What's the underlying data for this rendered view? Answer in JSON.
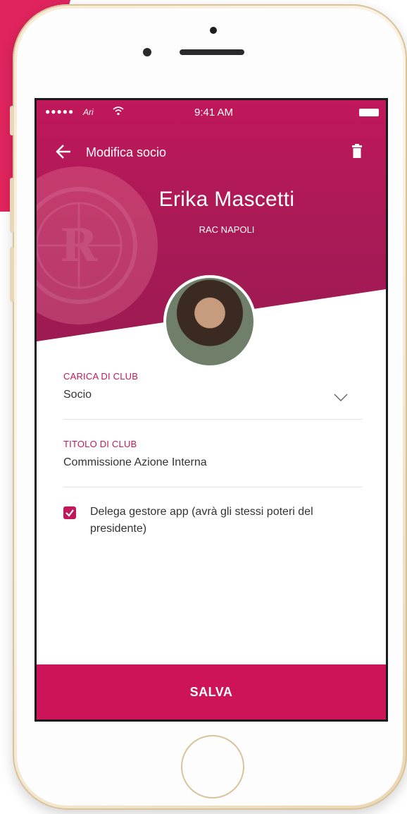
{
  "colors": {
    "accent": "#c0185a",
    "header": "#a81a55",
    "save_bar": "#cd1458",
    "background_slash": "#e0245e"
  },
  "status_bar": {
    "signal": "●●●●●",
    "carrier": "Ari",
    "wifi_icon": "wifi-icon",
    "time": "9:41 AM",
    "battery_icon": "battery-icon"
  },
  "app_bar": {
    "back_icon": "arrow-left-icon",
    "title": "Modifica socio",
    "delete_icon": "trash-icon"
  },
  "profile": {
    "name": "Erika Mascetti",
    "club": "RAC NAPOLI",
    "emblem_icon": "rotaract-club-emblem"
  },
  "form": {
    "carica": {
      "label": "CARICA DI CLUB",
      "value": "Socio",
      "icon": "chevron-down-icon"
    },
    "titolo": {
      "label": "TITOLO DI CLUB",
      "value": "Commissione Azione Interna"
    },
    "delega": {
      "checked": true,
      "label": "Delega gestore app (avrà gli stessi poteri del presidente)"
    }
  },
  "footer": {
    "save_label": "SALVA"
  }
}
